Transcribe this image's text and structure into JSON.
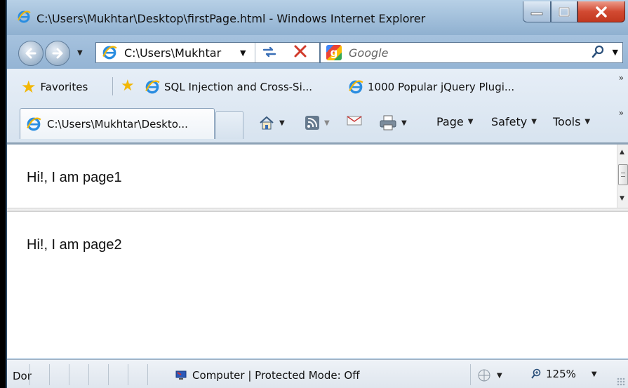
{
  "window": {
    "title": "C:\\Users\\Mukhtar\\Desktop\\firstPage.html - Windows Internet Explorer",
    "controls": {
      "minimize": "—",
      "maximize": "□",
      "close": "X"
    }
  },
  "navigation": {
    "address": "C:\\Users\\Mukhtar",
    "search_placeholder": "Google"
  },
  "favorites_bar": {
    "favorites_label": "Favorites",
    "links": [
      {
        "label": "SQL Injection and Cross-Si..."
      },
      {
        "label": "1000 Popular jQuery Plugi..."
      }
    ]
  },
  "tab": {
    "label": "C:\\Users\\Mukhtar\\Deskto..."
  },
  "command_bar": {
    "page": "Page",
    "safety": "Safety",
    "tools": "Tools"
  },
  "content": {
    "frame1_text": "Hi!, I am page1",
    "frame2_text": "Hi!, I am page2"
  },
  "status_bar": {
    "status": "Dor",
    "zone": "Computer | Protected Mode: Off",
    "zoom": "125%"
  },
  "colors": {
    "frame": "#9fbdd9",
    "close_button": "#d24a32",
    "favorites_star": "#f2b705"
  },
  "icons": [
    "ie-logo-icon",
    "back-arrow-icon",
    "forward-arrow-icon",
    "refresh-icon",
    "stop-icon",
    "google-icon",
    "search-icon",
    "star-icon",
    "add-favorite-icon",
    "home-icon",
    "rss-feed-icon",
    "read-mail-icon",
    "print-icon",
    "computer-zone-icon",
    "zoom-icon"
  ]
}
